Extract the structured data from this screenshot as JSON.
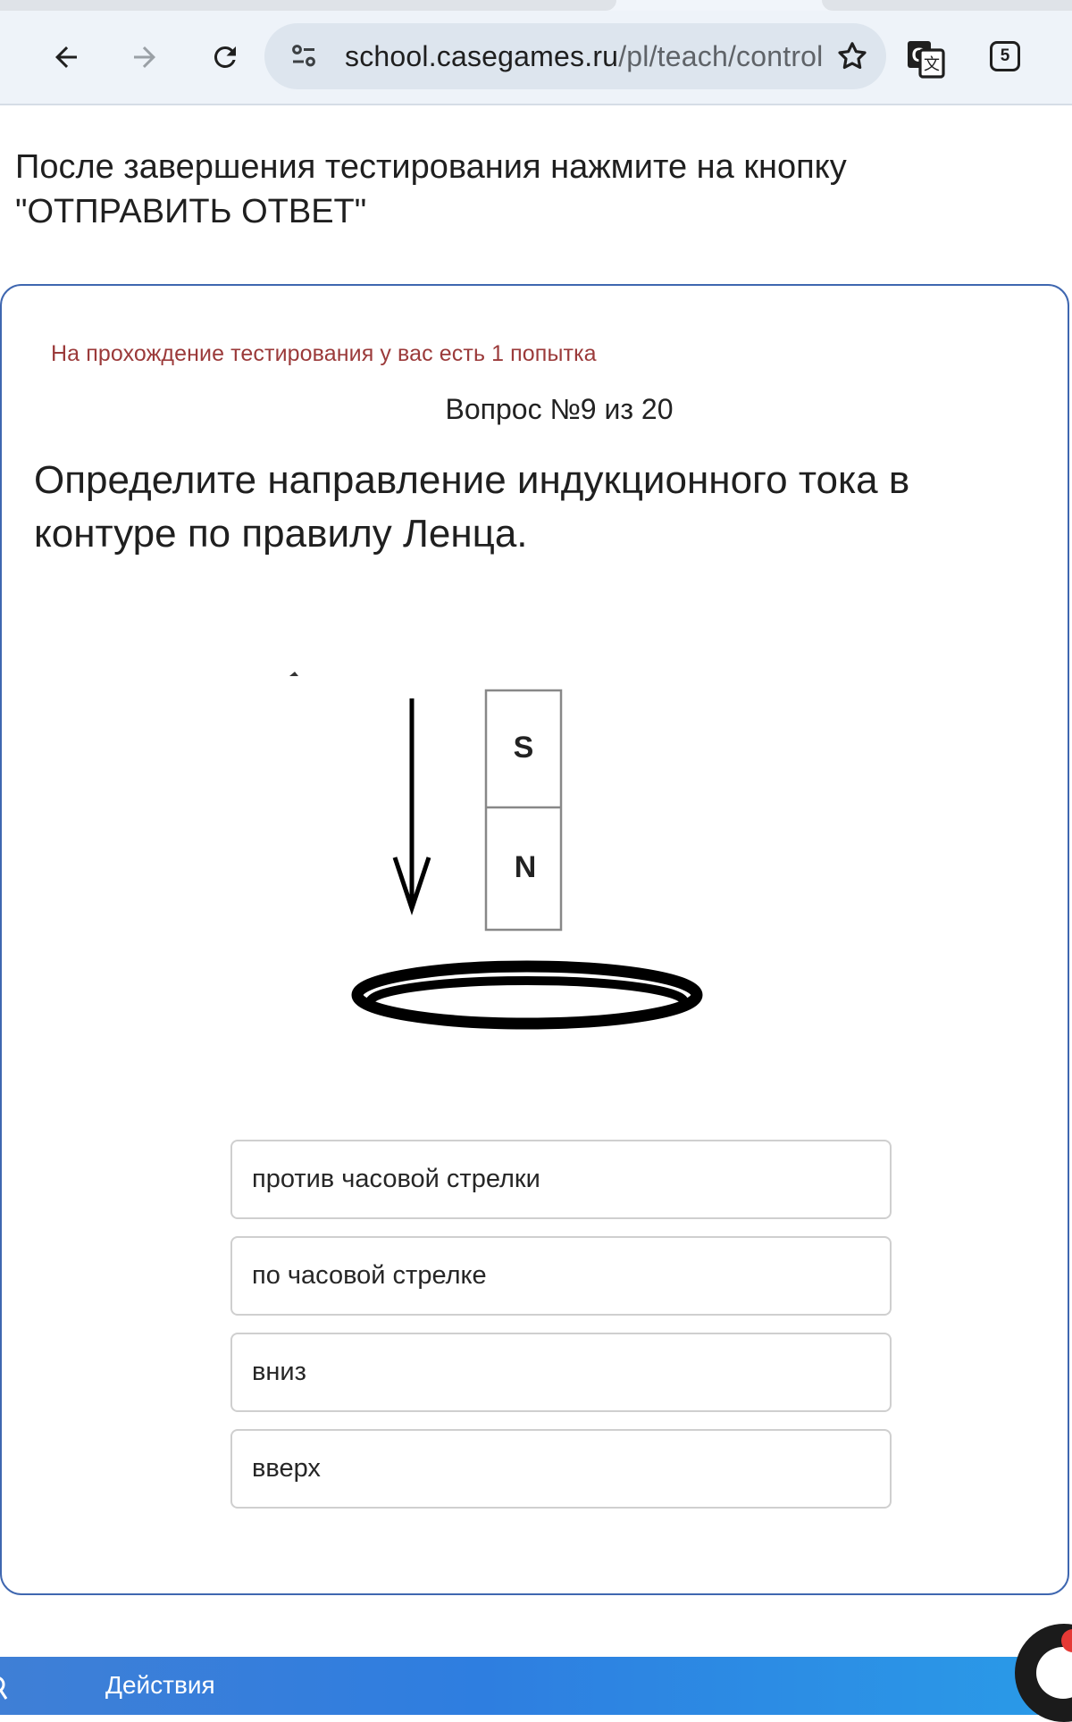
{
  "browser": {
    "url_host": "school.casegames.ru",
    "url_path": "/pl/teach/control",
    "tab_count": "5",
    "icons": {
      "back": "arrow-left-icon",
      "forward": "arrow-right-icon",
      "reload": "reload-icon",
      "site_info": "tune-icon",
      "bookmark": "star-icon",
      "translate": "translate-icon"
    }
  },
  "page": {
    "instruction": "После завершения тестирования нажмите на кнопку \"ОТПРАВИТЬ ОТВЕТ\""
  },
  "quiz": {
    "attempts_note": "На прохождение тестирования у вас есть 1 попытка",
    "question_number": "Вопрос №9 из 20",
    "question_text": "Определите направление индукционного тока в контуре по правилу Ленца.",
    "figure": {
      "magnet_top_pole": "S",
      "magnet_bottom_pole": "N"
    },
    "options": [
      {
        "label": "против часовой стрелки"
      },
      {
        "label": "по часовой стрелке"
      },
      {
        "label": "вниз"
      },
      {
        "label": "вверх"
      }
    ]
  },
  "footer": {
    "actions_label": "Действия"
  },
  "colors": {
    "card_border": "#3f67b0",
    "attempts_text": "#9b3a3a",
    "actions_bar": "#2e7ee0"
  }
}
